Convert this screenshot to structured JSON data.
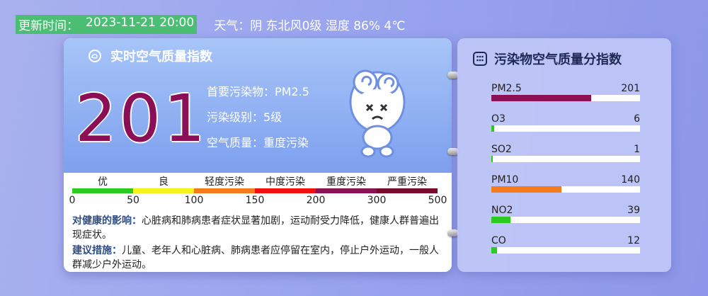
{
  "header": {
    "update_label": "更新时间：",
    "update_time": "2023-11-21 20:00",
    "weather": "天气：阴 东北风0级 湿度 86% 4℃"
  },
  "main": {
    "title": "实时空气质量指数",
    "aqi": "201",
    "primary_pollutant": "首要污染物：PM2.5",
    "level": "污染级别：5级",
    "quality": "空气质量：重度污染",
    "scale": {
      "levels": [
        "优",
        "良",
        "轻度污染",
        "中度污染",
        "重度污染",
        "严重污染"
      ],
      "colors": [
        "#2bcc1f",
        "#f6f21e",
        "#f47c1c",
        "#f2100e",
        "#8c1154",
        "#7a0a2a"
      ],
      "ticks": [
        "0",
        "50",
        "100",
        "150",
        "200",
        "300",
        "500"
      ]
    },
    "health_label": "对健康的影响：",
    "health_text": "心脏病和肺病患者症状显著加剧，运动耐受力降低，健康人群普遍出现症状。",
    "advice_label": "建议措施：",
    "advice_text": "儿童、老年人和心脏病、肺病患者应停留在室内，停止户外运动，一般人群减少户外运动。"
  },
  "side": {
    "title": "污染物空气质量分指数",
    "pollutants": [
      {
        "name": "PM2.5",
        "value": "201",
        "level_fraction": 0.67,
        "color": "#8c1154"
      },
      {
        "name": "O3",
        "value": "6",
        "level_fraction": 0.02,
        "color": "#2bcc1f"
      },
      {
        "name": "SO2",
        "value": "1",
        "level_fraction": 0.005,
        "color": "#2bcc1f"
      },
      {
        "name": "PM10",
        "value": "140",
        "level_fraction": 0.47,
        "color": "#f47c1c"
      },
      {
        "name": "NO2",
        "value": "39",
        "level_fraction": 0.13,
        "color": "#2bcc1f"
      },
      {
        "name": "CO",
        "value": "12",
        "level_fraction": 0.04,
        "color": "#2bcc1f"
      }
    ]
  }
}
